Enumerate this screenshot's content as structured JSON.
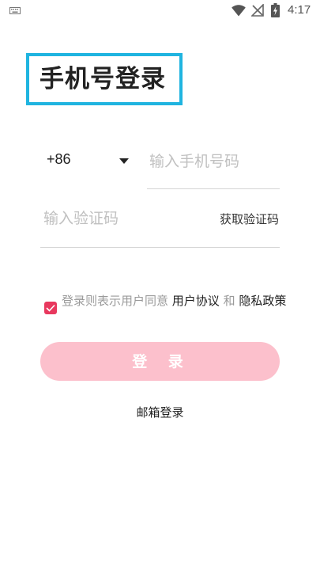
{
  "status_bar": {
    "time": "4:17",
    "icons": [
      "keyboard-icon",
      "wifi-icon",
      "no-signal-icon",
      "battery-charging-icon"
    ]
  },
  "title": "手机号登录",
  "phone": {
    "country_code": "+86",
    "placeholder": "输入手机号码"
  },
  "verification": {
    "placeholder": "输入验证码",
    "get_code_label": "获取验证码"
  },
  "agreement": {
    "checked": true,
    "prefix": "登录则表示用户同意",
    "user_agreement": "用户协议",
    "and": "和",
    "privacy_policy": "隐私政策"
  },
  "login_button": "登 录",
  "email_login": "邮箱登录",
  "colors": {
    "accent": "#e8385e",
    "button_bg": "#fcc0cc",
    "title_highlight": "#1fb4e0"
  }
}
